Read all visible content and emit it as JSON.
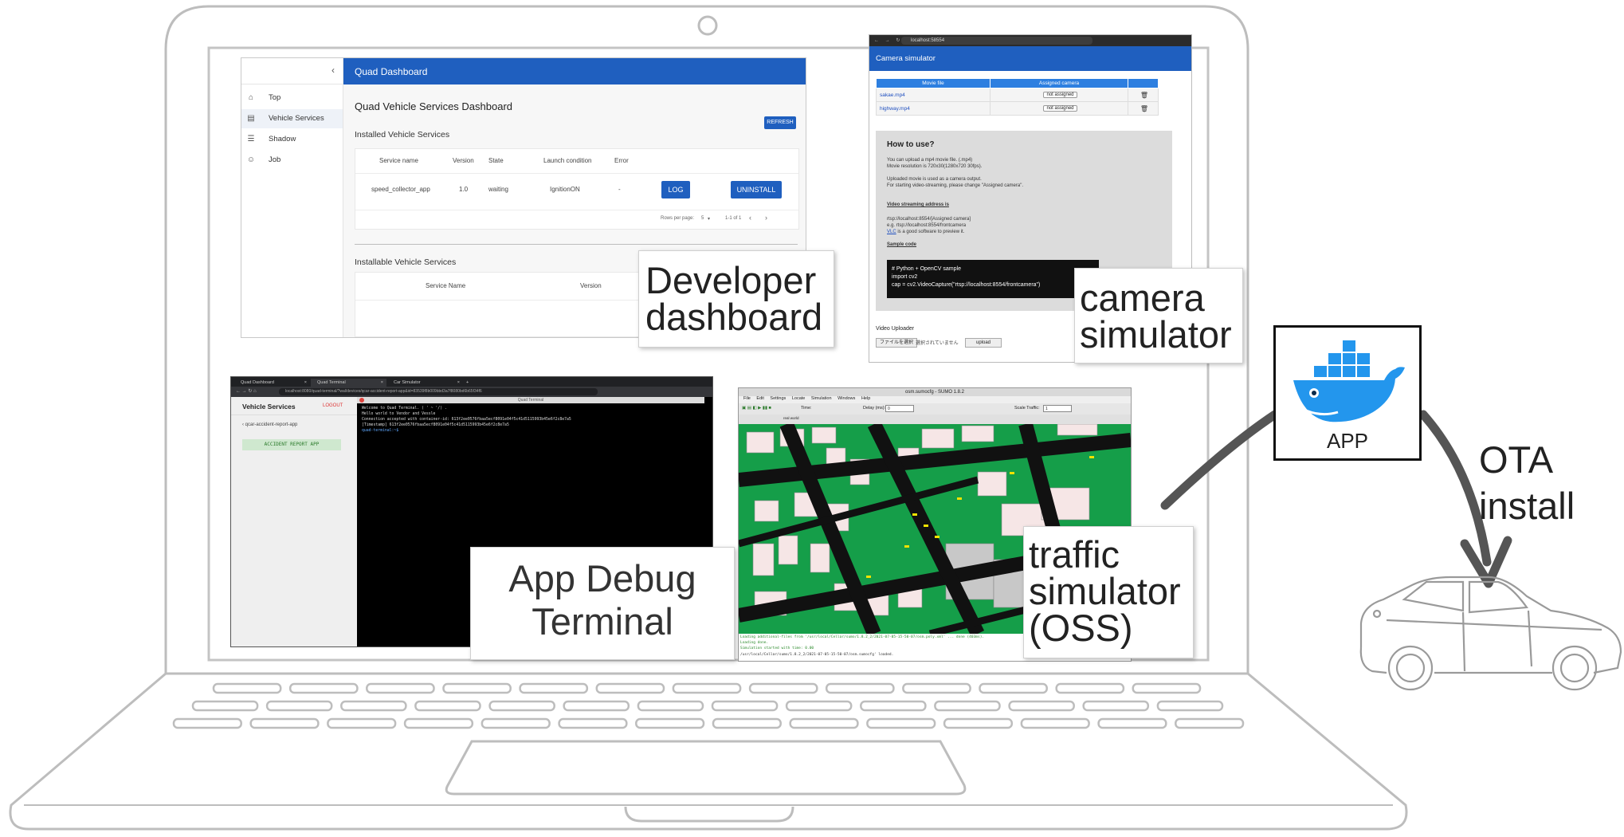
{
  "dashboard": {
    "header_title": "Quad Dashboard",
    "page_title": "Quad Vehicle Services Dashboard",
    "nav": [
      {
        "icon": "home-icon",
        "label": "Top"
      },
      {
        "icon": "list-icon",
        "label": "Vehicle Services"
      },
      {
        "icon": "menu-icon",
        "label": "Shadow"
      },
      {
        "icon": "person-icon",
        "label": "Job"
      }
    ],
    "refresh_label": "REFRESH",
    "installed_title": "Installed Vehicle Services",
    "installed_columns": [
      "Service name",
      "Version",
      "State",
      "Launch condition",
      "Error"
    ],
    "installed_row": [
      "speed_collector_app",
      "1.0",
      "waiting",
      "IgnitionON",
      "-"
    ],
    "log_label": "LOG",
    "uninstall_label": "UNINSTALL",
    "rows_per_page_label": "Rows per page:",
    "rows_per_page_value": "5",
    "page_range": "1-1 of 1",
    "installable_title": "Installable Vehicle Services",
    "installable_columns": [
      "Service Name",
      "Version"
    ],
    "label": "Developer dashboard"
  },
  "camera": {
    "url": "localhost:58554",
    "header_title": "Camera simulator",
    "columns": [
      "Movie file",
      "Assigned camera",
      ""
    ],
    "rows": [
      {
        "file": "sakae.mp4",
        "camera": "not assigned"
      },
      {
        "file": "highway.mp4",
        "camera": "not assigned"
      }
    ],
    "howto_title": "How to use?",
    "howto_lines": [
      "You can upload a mp4 movie file. (.mp4)",
      "Movie resolution is 720x30(1280x720 30fps).",
      "Uploaded movie is used as a camera output.",
      "For starting video-streaming, please change \"Assigned camera\"."
    ],
    "streaming_title": "Video streaming address is",
    "streaming_lines": [
      "rtsp://localhost:8554/[Assigned camera]",
      "e.g. rtsp://localhost:8554/frontcamera"
    ],
    "vlc_link": "VLC",
    "vlc_text": " is a good software to preview it.",
    "sample_title": "Sample code",
    "code_lines": [
      "# Python + OpenCV sample",
      "import cv2",
      "cap = cv2.VideoCapture(\"rtsp://localhost:8554/frontcamera\")"
    ],
    "uploader_title": "Video Uploader",
    "choose_file_label": "ファイルを選択",
    "no_file_text": "選択されていません",
    "upload_label": "upload",
    "label": "camera simulator"
  },
  "terminal": {
    "tabs": [
      "Quad Dashboard",
      "Quad Terminal",
      "Car Simulator"
    ],
    "url": "localhost:8080/quad-terminal/?wal/devices/qcar-accident-report-app&id=83539f8b009bbd3a7f8080bd6b65f34f6",
    "sidebar_title": "Vehicle Services",
    "logout_label": "LOGOUT",
    "back_label": "qcar-accident-report-app",
    "app_label": "ACCIDENT REPORT APP",
    "window_title": "Quad Terminal",
    "lines": [
      "Welcome to Quad Terminal. ( ' ~ '/) .",
      "Hello world to Vendor and Vessle",
      "Connection accepted with container-id: 613f2ee0576fbaa5ecf8091e04f5c41d5115993b45e6f2c8e7a5",
      "[Timestamp] 613f2ee0576fbaa5ecf8091e04f5c41d5115993b45e6f2c8e7a5",
      "quad-terminal:~$"
    ],
    "label_line1": "App Debug",
    "label_line2": "Terminal"
  },
  "traffic": {
    "window_title": "osm.sumocfg - SUMO 1.8.2",
    "menu": [
      "File",
      "Edit",
      "Settings",
      "Locate",
      "Simulation",
      "Windows",
      "Help"
    ],
    "time_label": "Time:",
    "delay_label": "Delay (ms):",
    "delay_value": "0",
    "scale_label": "Scale Traffic:",
    "scale_value": "1",
    "view_value": "real world",
    "log_lines": [
      "Loading additional-files from '/usr/local/Cellar/sumo/1.8.2_2/2021-07-05-15-50-07/osm.poly.xml' ... done (403ms).",
      "Loading done.",
      "Simulation started with time: 0.00",
      "/usr/local/Cellar/sumo/1.8.2_2/2021-07-05-15-50-07/osm.sumocfg' loaded."
    ],
    "label_line1": "traffic",
    "label_line2": "simulator",
    "label_line3": "(OSS)"
  },
  "app_card": {
    "label": "APP",
    "icon": "docker-whale-icon"
  },
  "ota": {
    "line1": "OTA",
    "line2": "install"
  },
  "colors": {
    "accent_blue": "#1f5fbf",
    "docker_blue": "#2396ed",
    "map_green": "#159e49",
    "outline_gray": "#bdbdbd",
    "arrow_gray": "#555555"
  }
}
